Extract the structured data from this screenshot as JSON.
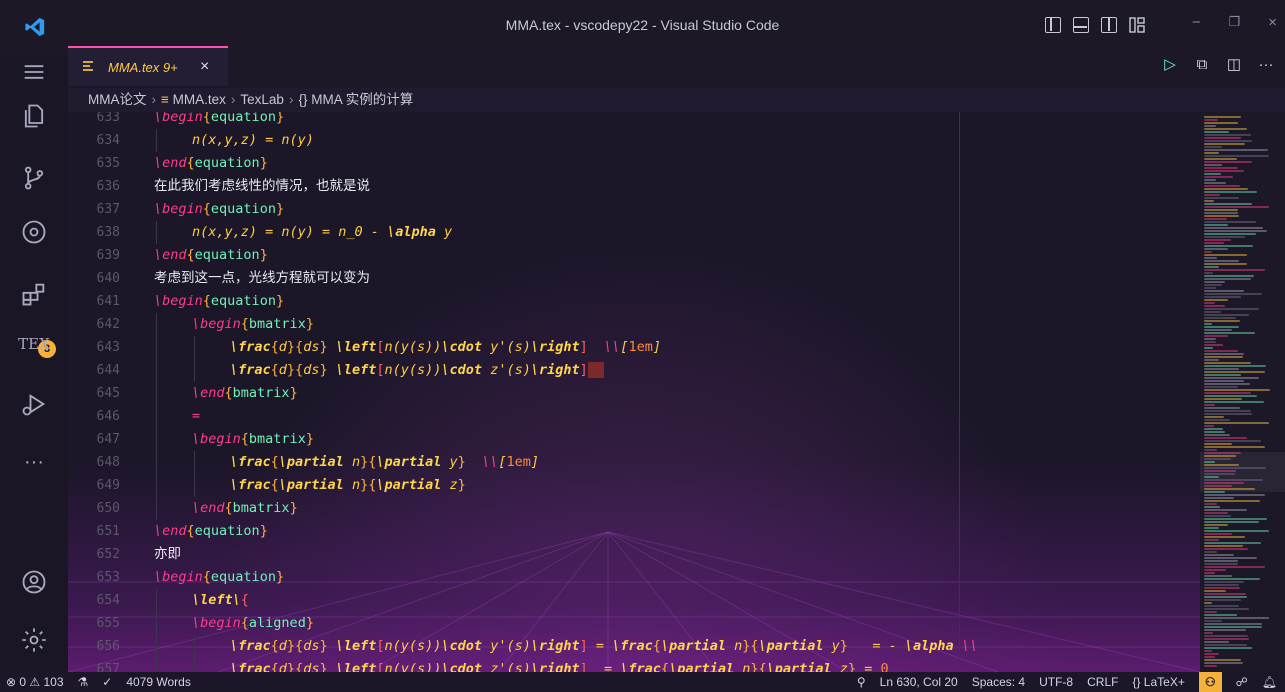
{
  "titlebar": {
    "title": "MMA.tex - vscodepy22 - Visual Studio Code",
    "close": "×",
    "min": "−",
    "max": "❐"
  },
  "activity": {
    "extensions_badge": "3",
    "tex_label": "TEX"
  },
  "tab": {
    "label": "MMA.tex 9+",
    "close": "×"
  },
  "breadcrumb": [
    "MMA论文",
    "MMA.tex",
    "TexLab",
    "{} MMA 实例的计算"
  ],
  "editor_lines": [
    {
      "n": "633",
      "segs": [
        [
          "k",
          "\\begin"
        ],
        [
          "b",
          "{"
        ],
        [
          "e",
          "equation"
        ],
        [
          "b",
          "}"
        ]
      ],
      "indent": 0
    },
    {
      "n": "634",
      "segs": [
        [
          "m",
          "n(x,y,z) = n(y)"
        ]
      ],
      "indent": 1
    },
    {
      "n": "635",
      "segs": [
        [
          "k",
          "\\end"
        ],
        [
          "b",
          "{"
        ],
        [
          "e",
          "equation"
        ],
        [
          "b",
          "}"
        ]
      ],
      "indent": 0
    },
    {
      "n": "636",
      "segs": [
        [
          "t",
          "在此我们考虑线性的情况，也就是说"
        ]
      ],
      "indent": 0
    },
    {
      "n": "637",
      "segs": [
        [
          "k",
          "\\begin"
        ],
        [
          "b",
          "{"
        ],
        [
          "e",
          "equation"
        ],
        [
          "b",
          "}"
        ]
      ],
      "indent": 0
    },
    {
      "n": "638",
      "segs": [
        [
          "m",
          "n(x,y,z) = n(y) = n_0 - "
        ],
        [
          "cmd",
          "\\alpha"
        ],
        [
          "m",
          " y"
        ]
      ],
      "indent": 1
    },
    {
      "n": "639",
      "segs": [
        [
          "k",
          "\\end"
        ],
        [
          "b",
          "{"
        ],
        [
          "e",
          "equation"
        ],
        [
          "b",
          "}"
        ]
      ],
      "indent": 0
    },
    {
      "n": "640",
      "segs": [
        [
          "t",
          "考虑到这一点，光线方程就可以变为"
        ]
      ],
      "indent": 0
    },
    {
      "n": "641",
      "segs": [
        [
          "k",
          "\\begin"
        ],
        [
          "b",
          "{"
        ],
        [
          "e",
          "equation"
        ],
        [
          "b",
          "}"
        ]
      ],
      "indent": 0
    },
    {
      "n": "642",
      "segs": [
        [
          "k",
          "\\begin"
        ],
        [
          "b",
          "{"
        ],
        [
          "e",
          "bmatrix"
        ],
        [
          "b",
          "}"
        ]
      ],
      "indent": 1
    },
    {
      "n": "643",
      "segs": [
        [
          "cmd",
          "\\frac"
        ],
        [
          "b",
          "{"
        ],
        [
          "m",
          "d"
        ],
        [
          "b",
          "}{"
        ],
        [
          "m",
          "ds"
        ],
        [
          "b",
          "}"
        ],
        [
          "m",
          " "
        ],
        [
          "cmd",
          "\\left"
        ],
        [
          "brk",
          "["
        ],
        [
          "m",
          "n(y(s))"
        ],
        [
          "cmd",
          "\\cdot"
        ],
        [
          "m",
          " y'(s)"
        ],
        [
          "cmd",
          "\\right"
        ],
        [
          "brk",
          "]"
        ],
        [
          "m",
          "  "
        ],
        [
          "k",
          "\\\\"
        ],
        [
          "m",
          "["
        ],
        [
          "num",
          "1em"
        ],
        [
          "m",
          "]"
        ]
      ],
      "indent": 2
    },
    {
      "n": "644",
      "segs": [
        [
          "cmd",
          "\\frac"
        ],
        [
          "b",
          "{"
        ],
        [
          "m",
          "d"
        ],
        [
          "b",
          "}{"
        ],
        [
          "m",
          "ds"
        ],
        [
          "b",
          "}"
        ],
        [
          "m",
          " "
        ],
        [
          "cmd",
          "\\left"
        ],
        [
          "brk",
          "["
        ],
        [
          "m",
          "n(y(s))"
        ],
        [
          "cmd",
          "\\cdot"
        ],
        [
          "m",
          " z'(s)"
        ],
        [
          "cmd",
          "\\right"
        ],
        [
          "brk",
          "]"
        ],
        [
          "hl",
          "  "
        ]
      ],
      "indent": 2
    },
    {
      "n": "645",
      "segs": [
        [
          "k",
          "\\end"
        ],
        [
          "b",
          "{"
        ],
        [
          "e",
          "bmatrix"
        ],
        [
          "b",
          "}"
        ]
      ],
      "indent": 1
    },
    {
      "n": "646",
      "segs": [
        [
          "k",
          "="
        ]
      ],
      "indent": 1
    },
    {
      "n": "647",
      "segs": [
        [
          "k",
          "\\begin"
        ],
        [
          "b",
          "{"
        ],
        [
          "e",
          "bmatrix"
        ],
        [
          "b",
          "}"
        ]
      ],
      "indent": 1
    },
    {
      "n": "648",
      "segs": [
        [
          "cmd",
          "\\frac"
        ],
        [
          "b",
          "{"
        ],
        [
          "cmd",
          "\\partial"
        ],
        [
          "m",
          " n"
        ],
        [
          "b",
          "}{"
        ],
        [
          "cmd",
          "\\partial"
        ],
        [
          "m",
          " y"
        ],
        [
          "b",
          "}"
        ],
        [
          "m",
          "  "
        ],
        [
          "k",
          "\\\\"
        ],
        [
          "m",
          "["
        ],
        [
          "num",
          "1em"
        ],
        [
          "m",
          "]"
        ]
      ],
      "indent": 2
    },
    {
      "n": "649",
      "segs": [
        [
          "cmd",
          "\\frac"
        ],
        [
          "b",
          "{"
        ],
        [
          "cmd",
          "\\partial"
        ],
        [
          "m",
          " n"
        ],
        [
          "b",
          "}{"
        ],
        [
          "cmd",
          "\\partial"
        ],
        [
          "m",
          " z"
        ],
        [
          "b",
          "}"
        ]
      ],
      "indent": 2
    },
    {
      "n": "650",
      "segs": [
        [
          "k",
          "\\end"
        ],
        [
          "b",
          "{"
        ],
        [
          "e",
          "bmatrix"
        ],
        [
          "b",
          "}"
        ]
      ],
      "indent": 1
    },
    {
      "n": "651",
      "segs": [
        [
          "k",
          "\\end"
        ],
        [
          "b",
          "{"
        ],
        [
          "e",
          "equation"
        ],
        [
          "b",
          "}"
        ]
      ],
      "indent": 0
    },
    {
      "n": "652",
      "segs": [
        [
          "t",
          "亦即"
        ]
      ],
      "indent": 0
    },
    {
      "n": "653",
      "segs": [
        [
          "k",
          "\\begin"
        ],
        [
          "b",
          "{"
        ],
        [
          "e",
          "equation"
        ],
        [
          "b",
          "}"
        ]
      ],
      "indent": 0
    },
    {
      "n": "654",
      "segs": [
        [
          "cmd",
          "\\left"
        ],
        [
          "cmd",
          "\\"
        ],
        [
          "brk",
          "{"
        ]
      ],
      "indent": 1
    },
    {
      "n": "655",
      "segs": [
        [
          "k",
          "\\begin"
        ],
        [
          "b",
          "{"
        ],
        [
          "e",
          "aligned"
        ],
        [
          "b",
          "}"
        ]
      ],
      "indent": 1
    },
    {
      "n": "656",
      "segs": [
        [
          "cmd",
          "\\frac"
        ],
        [
          "b",
          "{"
        ],
        [
          "m",
          "d"
        ],
        [
          "b",
          "}{"
        ],
        [
          "m",
          "ds"
        ],
        [
          "b",
          "}"
        ],
        [
          "m",
          " "
        ],
        [
          "cmd",
          "\\left"
        ],
        [
          "brk",
          "["
        ],
        [
          "m",
          "n(y(s))"
        ],
        [
          "cmd",
          "\\cdot"
        ],
        [
          "m",
          " y'(s)"
        ],
        [
          "cmd",
          "\\right"
        ],
        [
          "brk",
          "]"
        ],
        [
          "m",
          " = "
        ],
        [
          "cmd",
          "\\frac"
        ],
        [
          "b",
          "{"
        ],
        [
          "cmd",
          "\\partial"
        ],
        [
          "m",
          " n"
        ],
        [
          "b",
          "}{"
        ],
        [
          "cmd",
          "\\partial"
        ],
        [
          "m",
          " y"
        ],
        [
          "b",
          "}"
        ],
        [
          "m",
          "   = - "
        ],
        [
          "cmd",
          "\\alpha"
        ],
        [
          "m",
          " "
        ],
        [
          "k",
          "\\\\"
        ]
      ],
      "indent": 2
    },
    {
      "n": "657",
      "segs": [
        [
          "cmd",
          "\\frac"
        ],
        [
          "b",
          "{"
        ],
        [
          "m",
          "d"
        ],
        [
          "b",
          "}{"
        ],
        [
          "m",
          "ds"
        ],
        [
          "b",
          "}"
        ],
        [
          "m",
          " "
        ],
        [
          "cmd",
          "\\left"
        ],
        [
          "brk",
          "["
        ],
        [
          "m",
          "n(y(s))"
        ],
        [
          "cmd",
          "\\cdot"
        ],
        [
          "m",
          " z'(s)"
        ],
        [
          "cmd",
          "\\right"
        ],
        [
          "brk",
          "]"
        ],
        [
          "m",
          "  = "
        ],
        [
          "cmd",
          "\\frac"
        ],
        [
          "b",
          "{"
        ],
        [
          "cmd",
          "\\partial"
        ],
        [
          "m",
          " n"
        ],
        [
          "b",
          "}{"
        ],
        [
          "cmd",
          "\\partial"
        ],
        [
          "m",
          " z"
        ],
        [
          "b",
          "}"
        ],
        [
          "m",
          " = "
        ],
        [
          "num",
          "0"
        ]
      ],
      "indent": 2
    }
  ],
  "status": {
    "problems": "⊗ 0 ⚠ 103",
    "word_count": "4079 Words",
    "position": "Ln 630, Col 20",
    "spaces": "Spaces: 4",
    "encoding": "UTF-8",
    "eol": "CRLF",
    "language": "{} LaTeX+"
  },
  "colors": {
    "accent": "#ff4fb0",
    "keyword": "#ff3d8f",
    "math": "#ffcc44",
    "env": "#72f1b8",
    "badge": "#f6b13b"
  }
}
